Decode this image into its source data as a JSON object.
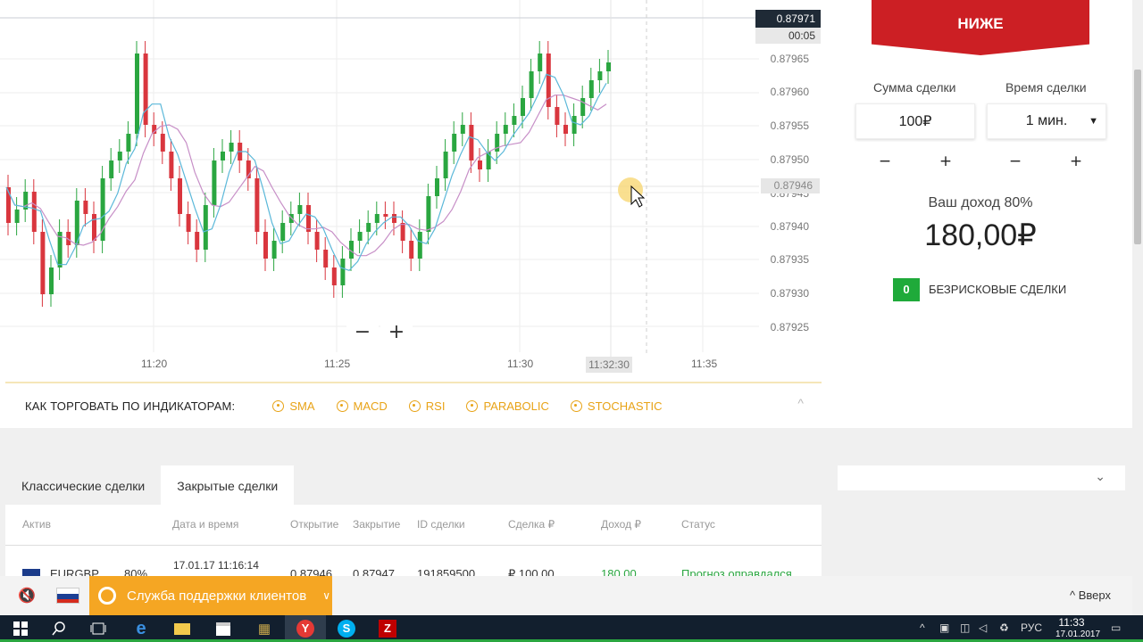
{
  "chart": {
    "current_price": "0.87971",
    "timer": "00:05",
    "cursor_price": "0.87946",
    "hover_time": "11:32:30",
    "price_ticks": [
      "0.87965",
      "0.87960",
      "0.87955",
      "0.87950",
      "0.87945",
      "0.87940",
      "0.87935",
      "0.87930",
      "0.87925"
    ],
    "time_ticks": [
      "11:20",
      "11:25",
      "11:30",
      "11:35"
    ],
    "zoom_out": "−",
    "zoom_in": "+",
    "colors": {
      "up": "#2aa640",
      "down": "#d9363e",
      "sma_fast": "#5bb8d9",
      "sma_slow": "#c78fc7",
      "grid": "#eeeeee"
    }
  },
  "indicators": {
    "title": "КАК ТОРГОВАТЬ ПО ИНДИКАТОРАМ:",
    "items": [
      "SMA",
      "MACD",
      "RSI",
      "PARABOLIC",
      "STOCHASTIC"
    ],
    "caret": "^"
  },
  "tabs": [
    "Классические сделки",
    "Закрытые сделки"
  ],
  "table": {
    "headers": [
      "Актив",
      "Дата и время",
      "Открытие",
      "Закрытие",
      "ID сделки",
      "Сделка ₽",
      "Доход ₽",
      "Статус"
    ],
    "row": {
      "asset": "EURGBP",
      "percent": "80%",
      "datetime": "17.01.17 11:16:14",
      "open": "0.87946",
      "close": "0.87947",
      "id": "191859500",
      "amount": "₽ 100,00",
      "income": "180,00",
      "status": "Прогноз оправдался"
    }
  },
  "trade_panel": {
    "lower_label": "НИЖЕ",
    "amount_label": "Сумма сделки",
    "time_label": "Время сделки",
    "amount_value": "100₽",
    "time_value": "1 мин.",
    "minus": "−",
    "plus": "+",
    "income_label": "Ваш доход 80%",
    "income_value": "180,00₽",
    "riskfree_count": "0",
    "riskfree_label": "БЕЗРИСКОВЫЕ СДЕЛКИ"
  },
  "bottom": {
    "support": "Служба поддержки клиентов",
    "up": "Вверх"
  },
  "taskbar": {
    "lang": "РУС",
    "time": "11:33",
    "date": "17.01.2017"
  }
}
